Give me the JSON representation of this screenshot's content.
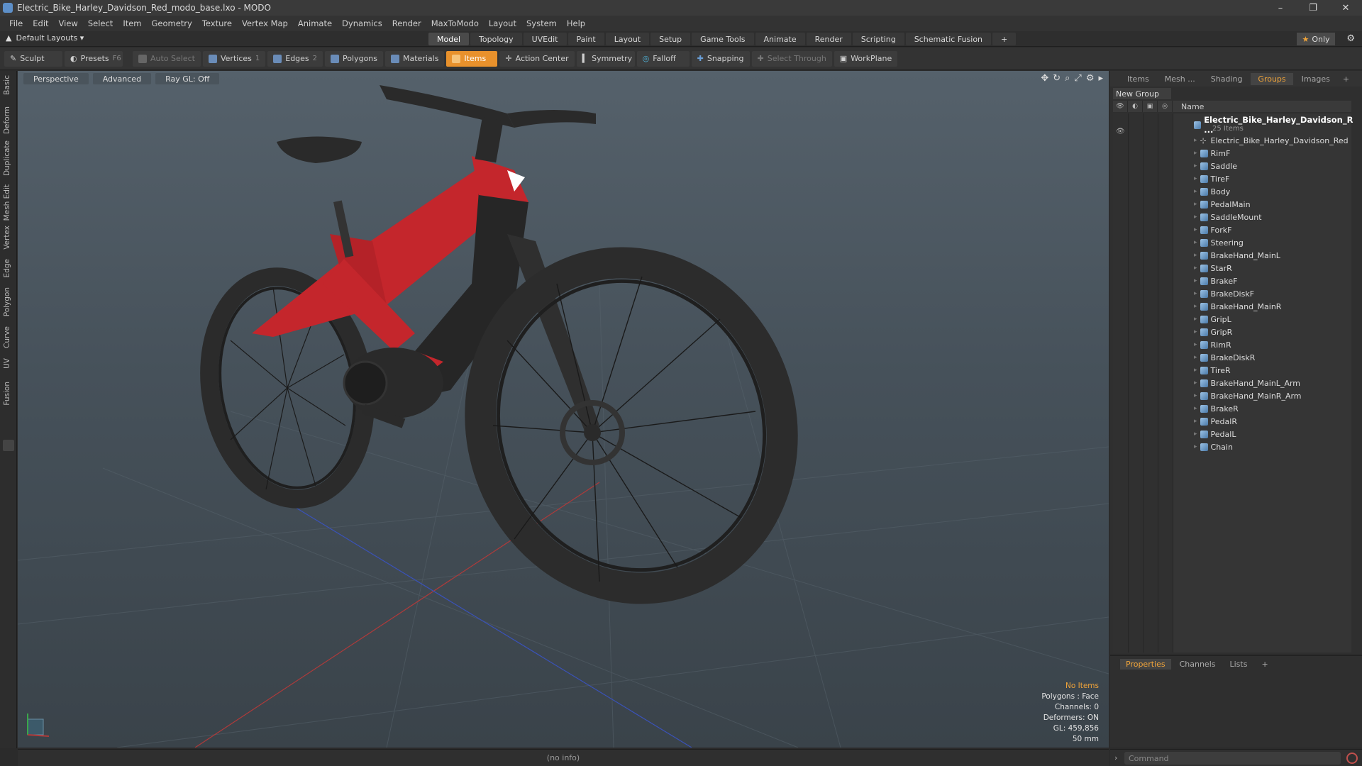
{
  "window": {
    "title": "Electric_Bike_Harley_Davidson_Red_modo_base.lxo - MODO",
    "controls": [
      "–",
      "❐",
      "✕"
    ]
  },
  "menu": [
    "File",
    "Edit",
    "View",
    "Select",
    "Item",
    "Geometry",
    "Texture",
    "Vertex Map",
    "Animate",
    "Dynamics",
    "Render",
    "MaxToModo",
    "Layout",
    "System",
    "Help"
  ],
  "layout_selector": "Default Layouts ▾",
  "tabs": [
    "Model",
    "Topology",
    "UVEdit",
    "Paint",
    "Layout",
    "Setup",
    "Game Tools",
    "Animate",
    "Render",
    "Scripting",
    "Schematic Fusion"
  ],
  "active_tab": "Model",
  "tab_add": "+",
  "only_label": "Only",
  "toolbar": {
    "sculpt": "Sculpt",
    "presets": "Presets",
    "presets_key": "F6",
    "auto_select": "Auto Select",
    "vertices": "Vertices",
    "vertices_count": "1",
    "edges": "Edges",
    "edges_count": "2",
    "polygons": "Polygons",
    "materials": "Materials",
    "items": "Items",
    "action_center": "Action Center",
    "symmetry": "Symmetry",
    "falloff": "Falloff",
    "snapping": "Snapping",
    "select_through": "Select Through",
    "workplane": "WorkPlane"
  },
  "left_tabs": [
    "Basic",
    "Deform",
    "Duplicate",
    "Mesh Edit",
    "Vertex",
    "Edge",
    "Polygon",
    "Curve",
    "UV",
    "Fusion"
  ],
  "viewport": {
    "view": "Perspective",
    "mode": "Advanced",
    "raygl": "Ray GL: Off",
    "info": {
      "no_items": "No Items",
      "polygons": "Polygons : Face",
      "channels": "Channels: 0",
      "deformers": "Deformers: ON",
      "gl": "GL: 459,856",
      "focal": "50 mm"
    }
  },
  "panel_tabs": [
    "Items",
    "Mesh ...",
    "Shading",
    "Groups",
    "Images"
  ],
  "active_panel_tab": "Groups",
  "new_group": "New Group",
  "name_col": "Name",
  "tree": {
    "root": "Electric_Bike_Harley_Davidson_R ...",
    "root_count": "25 Items",
    "items": [
      "Electric_Bike_Harley_Davidson_Red",
      "RimF",
      "Saddle",
      "TireF",
      "Body",
      "PedalMain",
      "SaddleMount",
      "ForkF",
      "Steering",
      "BrakeHand_MainL",
      "StarR",
      "BrakeF",
      "BrakeDiskF",
      "BrakeHand_MainR",
      "GripL",
      "GripR",
      "RimR",
      "BrakeDiskR",
      "TireR",
      "BrakeHand_MainL_Arm",
      "BrakeHand_MainR_Arm",
      "BrakeR",
      "PedalR",
      "PedalL",
      "Chain"
    ]
  },
  "props_tabs": [
    "Properties",
    "Channels",
    "Lists"
  ],
  "active_props_tab": "Properties",
  "status": "(no info)",
  "command_placeholder": "Command",
  "colors": {
    "accent": "#f0a43a",
    "frame_red": "#c9262c",
    "tire": "#2e2e2e"
  }
}
